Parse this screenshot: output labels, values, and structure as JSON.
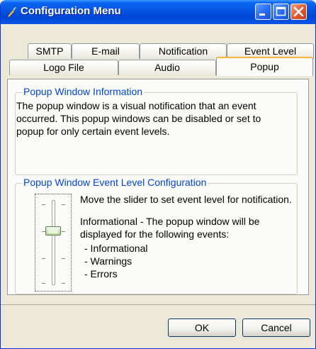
{
  "window": {
    "title": "Configuration Menu",
    "icons": {
      "app": "app-icon",
      "minimize": "minimize-icon",
      "maximize": "maximize-icon",
      "close": "close-icon"
    }
  },
  "tabs": {
    "row1": [
      "SMTP",
      "E-mail",
      "Notification",
      "Event Level"
    ],
    "row2": [
      "Logo File",
      "Audio",
      "Popup"
    ],
    "active": "Popup"
  },
  "popup_info": {
    "legend": "Popup Window Information",
    "text_lines": [
      "The popup window is a visual notification that an event",
      "occurred. This popup windows can be disabled or set to",
      "popup for only certain event levels."
    ]
  },
  "event_level": {
    "legend": "Popup Window Event Level Configuration",
    "instruction": "Move the slider to set event level for notification.",
    "description_lines": [
      "Informational - The popup window will be",
      "displayed for the following events:"
    ],
    "events": [
      "- Informational",
      "- Warnings",
      "- Errors"
    ],
    "slider_level": "Informational"
  },
  "buttons": {
    "ok": "OK",
    "cancel": "Cancel"
  }
}
